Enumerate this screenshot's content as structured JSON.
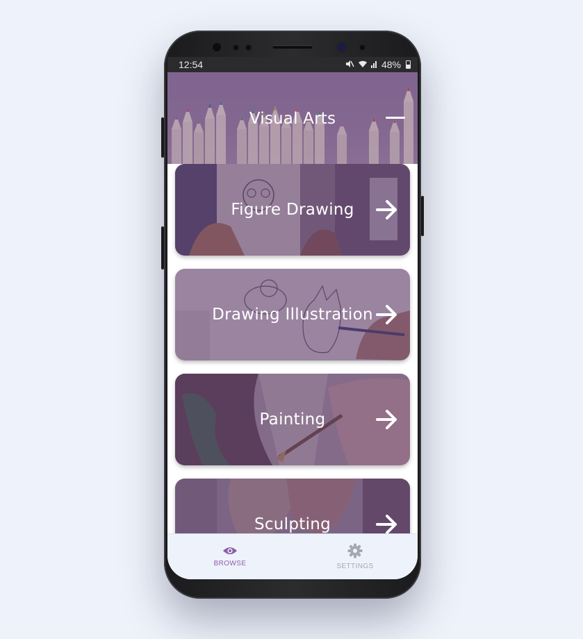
{
  "status_bar": {
    "time": "12:54",
    "battery": "48%"
  },
  "header": {
    "title": "Visual Arts"
  },
  "cards": [
    {
      "label": "Figure Drawing"
    },
    {
      "label": "Drawing Illustration"
    },
    {
      "label": "Painting"
    },
    {
      "label": "Sculpting"
    }
  ],
  "bottom_nav": {
    "browse_label": "BROWSE",
    "settings_label": "SETTINGS"
  },
  "colors": {
    "accent": "#8b5fa8",
    "inactive": "#a5a8b0",
    "card_tint": "#5c3a6e",
    "page_bg": "#eef2fa"
  },
  "icons": {
    "collapse": "minus-icon",
    "card_action": "arrow-right-icon",
    "browse": "eye-icon",
    "settings": "gear-icon"
  }
}
